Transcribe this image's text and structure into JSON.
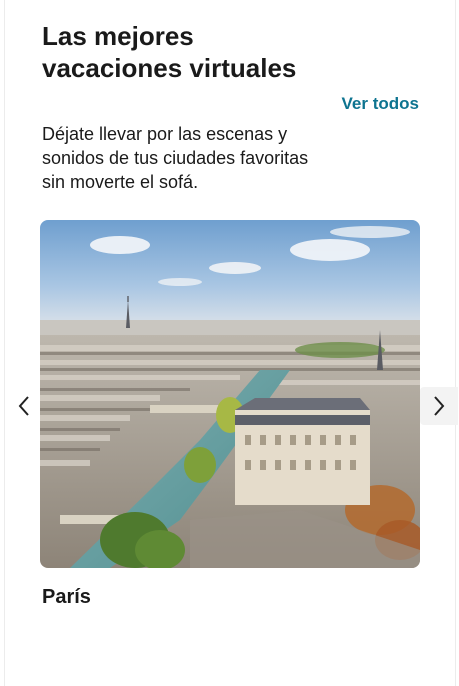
{
  "section": {
    "title": "Las mejores vacaciones virtuales",
    "see_all": "Ver todos",
    "subtitle": "Déjate llevar por las escenas y sonidos de tus ciudades favoritas sin moverte el sofá."
  },
  "carousel": {
    "slides": [
      {
        "label": "París"
      }
    ],
    "prev_icon": "chevron-left-icon",
    "next_icon": "chevron-right-icon"
  },
  "colors": {
    "link": "#0e7490",
    "text": "#1a1a1a"
  }
}
